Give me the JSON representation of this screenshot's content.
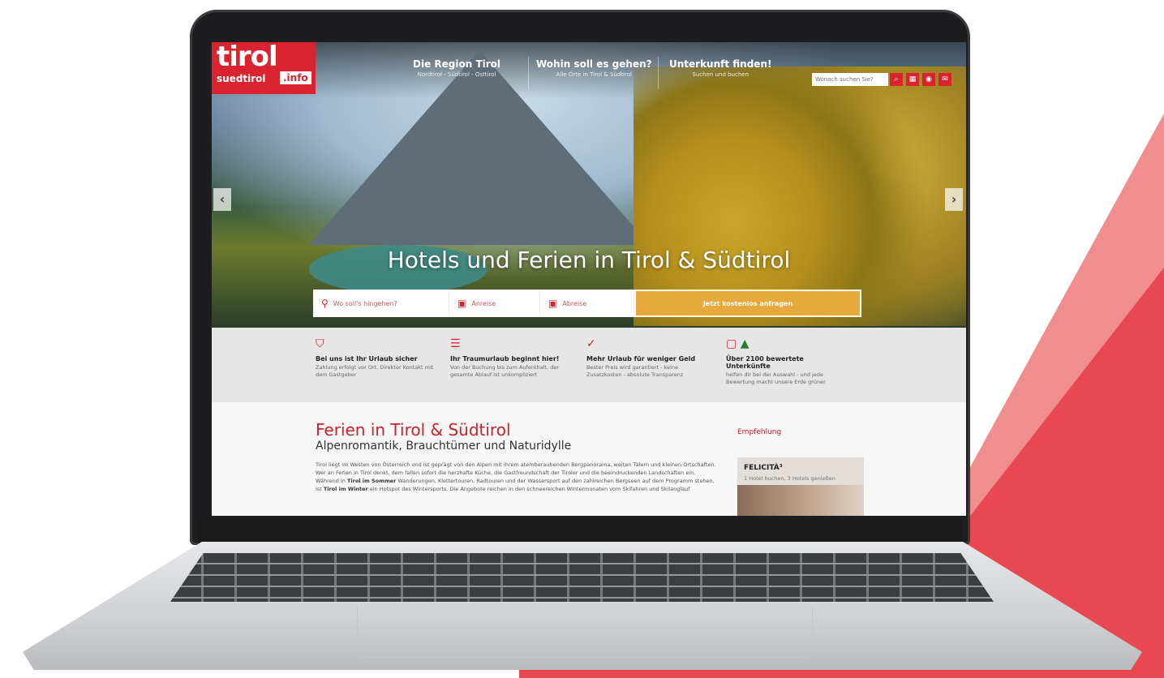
{
  "site": {
    "logo": {
      "word": "tirol",
      "sub": "suedtirol",
      "suffix": ".info"
    },
    "nav": [
      {
        "title": "Die Region Tirol",
        "subtitle": "Nordtirol - Südtirol - Osttirol"
      },
      {
        "title": "Wohin soll es gehen?",
        "subtitle": "Alle Orte in Tirol & Südtirol"
      },
      {
        "title": "Unterkunft finden!",
        "subtitle": "Suchen und buchen"
      }
    ],
    "top_search": {
      "placeholder": "Wonach suchen Sie?"
    },
    "header_icons": [
      "search-icon",
      "map-icon",
      "camera-icon",
      "mail-icon"
    ],
    "carousel": {
      "prev_symbol": "‹",
      "next_symbol": "›"
    },
    "hero_title": "Hotels und Ferien in Tirol & Südtirol",
    "booking": {
      "destination_placeholder": "Wo soll's hingehen?",
      "arrival_placeholder": "Anreise",
      "departure_placeholder": "Abreise",
      "submit_label": "Jetzt kostenlos anfragen"
    },
    "features": [
      {
        "icon": "shield-icon",
        "title": "Bei uns ist Ihr Urlaub sicher",
        "desc": "Zahlung erfolgt vor Ort. Direkter Kontakt mit dem Gastgeber"
      },
      {
        "icon": "calendar-icon",
        "title": "Ihr Traumurlaub beginnt hier!",
        "desc": "Von der Buchung bis zum Aufenthalt, der gesamte Ablauf ist unkompliziert"
      },
      {
        "icon": "check-icon",
        "title": "Mehr Urlaub für weniger Geld",
        "desc": "Bester Preis wird garantiert - keine Zusatzkosten - absolute Transparenz"
      },
      {
        "icon": "comment-tree-icon",
        "title": "Über 2100 bewertete Unterkünfte",
        "desc": "helfen dir bei der Auswahl - und jede Bewertung macht unsere Erde grüner"
      }
    ],
    "content": {
      "title": "Ferien in Tirol & Südtirol",
      "subtitle": "Alpenromantik, Brauchtümer und Naturidylle",
      "body_1": "Tirol liegt im Westen von Österreich und ist geprägt von den Alpen mit ihrem atemberaubenden Bergpanorama, weiten Tälern und kleinen Ortschaften. Wer an Ferien in Tirol denkt, dem fallen sofort die herzhafte Küche, die Gastfreundschaft der Tiroler und die beeindruckenden Landschaften ein. Während in ",
      "bold_1": "Tirol im Sommer",
      "body_2": " Wanderungen, Klettertouren, Radtouren und der Wassersport auf den zahlreichen Bergseen auf dem Programm stehen, ist ",
      "bold_2": "Tirol im Winter",
      "body_3": " ein Hotspot des Wintersports. Die Angebote reichen in den schneereichen Wintermonaten vom Skifahren und Skilanglauf"
    },
    "sidebar": {
      "label": "Empfehlung",
      "card_title": "FELICITÀ³",
      "card_desc": "1 Hotel buchen, 3 Hotels genießen"
    }
  }
}
